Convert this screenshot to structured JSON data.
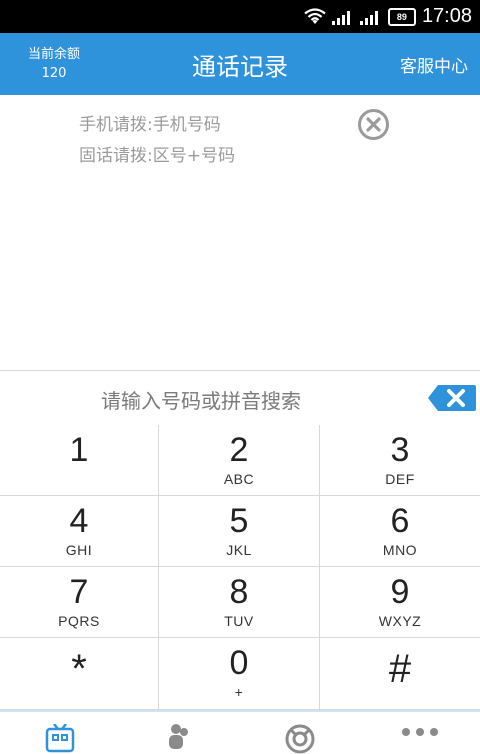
{
  "status_bar": {
    "time": "17:08",
    "battery": "89"
  },
  "header": {
    "balance_label": "当前余额",
    "balance_value": "120",
    "title": "通话记录",
    "service_label": "客服中心"
  },
  "hints": [
    "手机请拨:手机号码",
    "固话请拨:区号+号码"
  ],
  "search": {
    "placeholder": "请输入号码或拼音搜索"
  },
  "keypad": [
    {
      "num": "1",
      "letters": ""
    },
    {
      "num": "2",
      "letters": "ABC"
    },
    {
      "num": "3",
      "letters": "DEF"
    },
    {
      "num": "4",
      "letters": "GHI"
    },
    {
      "num": "5",
      "letters": "JKL"
    },
    {
      "num": "6",
      "letters": "MNO"
    },
    {
      "num": "7",
      "letters": "PQRS"
    },
    {
      "num": "8",
      "letters": "TUV"
    },
    {
      "num": "9",
      "letters": "WXYZ"
    },
    {
      "num": "*",
      "letters": ""
    },
    {
      "num": "0",
      "letters": "+"
    },
    {
      "num": "#",
      "letters": ""
    }
  ],
  "bottom_nav": [
    {
      "icon": "dialpad-icon",
      "active": true
    },
    {
      "icon": "contacts-icon",
      "active": false
    },
    {
      "icon": "support-icon",
      "active": false
    },
    {
      "icon": "more-icon",
      "active": false
    }
  ],
  "colors": {
    "primary": "#2f93dc",
    "accent_delete": "#2f93dc",
    "hint_text": "#9b9b9b"
  }
}
